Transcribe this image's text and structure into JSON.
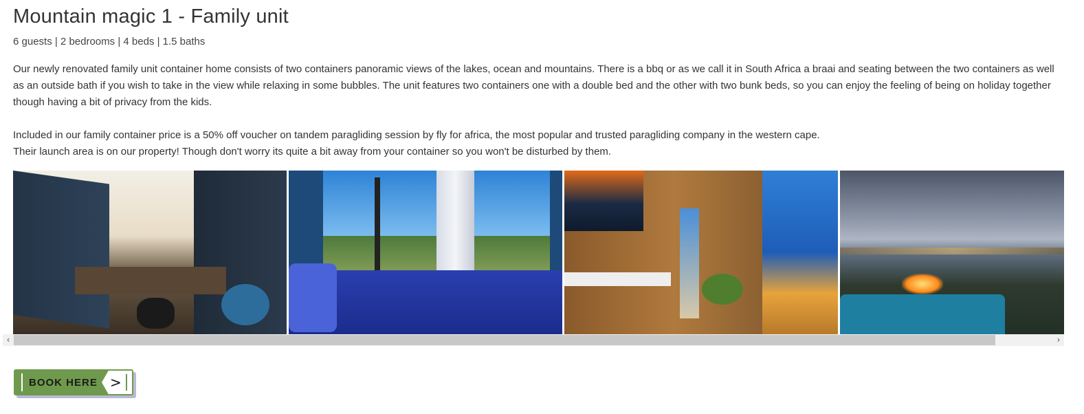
{
  "listing": {
    "title": "Mountain magic 1 - Family unit",
    "meta": "6 guests | 2 bedrooms | 4 beds | 1.5 baths",
    "description_1": "Our newly renovated family unit container home consists of two containers panoramic views of the lakes, ocean and mountains. There is a bbq or as we call it in South Africa a braai and seating between the two containers as well as an outside bath if you wish to take in the view while relaxing in some bubbles. The unit features two containers one with a double bed and the other with two bunk beds, so you can enjoy the feeling of being on holiday together though having a bit of privacy from the kids.",
    "description_2_line1": "Included in our family container price is a 50% off voucher on tandem paragliding session by fly for africa, the most popular and trusted paragliding company in the western cape.",
    "description_2_line2": "Their launch area is on our property! Though don't worry its quite a bit away from your container so you won't be disturbed by them."
  },
  "gallery": {
    "scroll_left_icon": "‹",
    "scroll_right_icon": "›"
  },
  "book_button": {
    "label": "BOOK HERE",
    "icon": ">",
    "accent": "#6f9a4d"
  }
}
